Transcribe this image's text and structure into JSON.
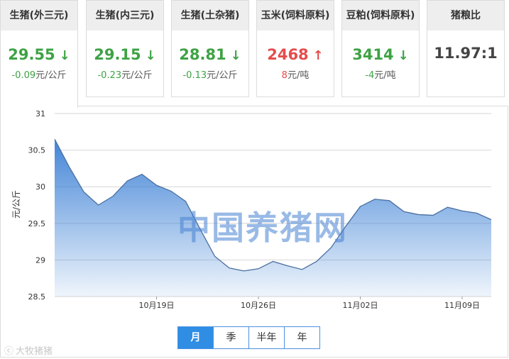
{
  "cards": [
    {
      "title": "生猪(外三元)",
      "price": "29.55",
      "direction": "down",
      "arrow": "↓",
      "change_value": "-0.09",
      "change_unit": "元/公斤"
    },
    {
      "title": "生猪(内三元)",
      "price": "29.15",
      "direction": "down",
      "arrow": "↓",
      "change_value": "-0.23",
      "change_unit": "元/公斤"
    },
    {
      "title": "生猪(土杂猪)",
      "price": "28.81",
      "direction": "down",
      "arrow": "↓",
      "change_value": "-0.13",
      "change_unit": "元/公斤"
    },
    {
      "title": "玉米(饲料原料)",
      "price": "2468",
      "direction": "up",
      "arrow": "↑",
      "change_value": "8",
      "change_unit": "元/吨"
    },
    {
      "title": "豆粕(饲料原料)",
      "price": "3414",
      "direction": "down",
      "arrow": "↓",
      "change_value": "-4",
      "change_unit": "元/吨"
    },
    {
      "title": "猪粮比",
      "ratio": "11.97:1"
    }
  ],
  "chart_data": {
    "type": "area",
    "ylabel": "元/公斤",
    "ylim": [
      28.5,
      31
    ],
    "yticks": [
      "31",
      "30.5",
      "30",
      "29.5",
      "29",
      "28.5"
    ],
    "xticks": [
      {
        "index": 7,
        "label": "10月19日"
      },
      {
        "index": 14,
        "label": "10月26日"
      },
      {
        "index": 21,
        "label": "11月02日"
      },
      {
        "index": 28,
        "label": "11月09日"
      }
    ],
    "series": [
      {
        "values": [
          30.65,
          30.27,
          29.93,
          29.75,
          29.87,
          30.08,
          30.17,
          30.02,
          29.94,
          29.8,
          29.42,
          29.05,
          28.89,
          28.85,
          28.88,
          28.98,
          28.92,
          28.87,
          28.98,
          29.17,
          29.46,
          29.73,
          29.83,
          29.81,
          29.66,
          29.62,
          29.61,
          29.72,
          29.67,
          29.64,
          29.55
        ],
        "color": "#3a7fd5"
      }
    ],
    "grid": true
  },
  "watermark": "中国养猪网",
  "periods": {
    "options": [
      "月",
      "季",
      "半年",
      "年"
    ],
    "selected": "月"
  },
  "corner_mark": "大牧猪猪"
}
